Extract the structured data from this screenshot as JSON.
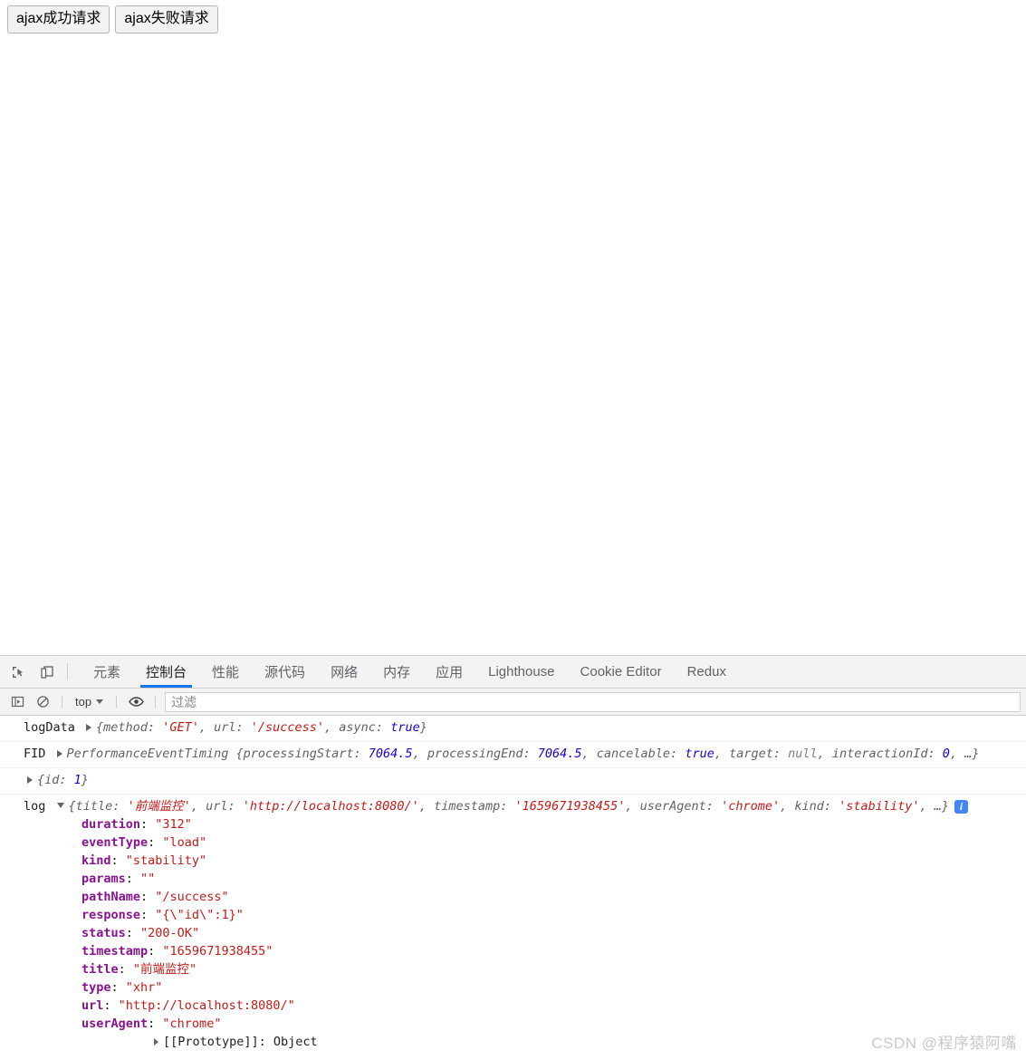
{
  "page": {
    "buttons": [
      {
        "label": "ajax成功请求",
        "name": "ajax-success-button"
      },
      {
        "label": "ajax失败请求",
        "name": "ajax-fail-button"
      }
    ]
  },
  "devtools": {
    "toolbar_icons": [
      {
        "name": "inspect-element-icon",
        "title": "检查元素"
      },
      {
        "name": "device-toolbar-icon",
        "title": "切换设备工具栏"
      }
    ],
    "tabs": [
      {
        "label": "元素",
        "active": false
      },
      {
        "label": "控制台",
        "active": true
      },
      {
        "label": "性能",
        "active": false
      },
      {
        "label": "源代码",
        "active": false
      },
      {
        "label": "网络",
        "active": false
      },
      {
        "label": "内存",
        "active": false
      },
      {
        "label": "应用",
        "active": false
      },
      {
        "label": "Lighthouse",
        "active": false
      },
      {
        "label": "Cookie Editor",
        "active": false
      },
      {
        "label": "Redux",
        "active": false
      }
    ],
    "filterbar": {
      "sidebar_icon": "console-sidebar-icon",
      "clear_icon": "clear-console-icon",
      "context": "top",
      "eye_icon": "live-expression-icon",
      "filter_placeholder": "过滤",
      "filter_value": ""
    }
  },
  "console": {
    "messages": [
      {
        "label": "logData",
        "expanded": false,
        "preview_parts": [
          {
            "t": "{method: ",
            "c": "preview"
          },
          {
            "t": "'GET'",
            "c": "str"
          },
          {
            "t": ", url: ",
            "c": "preview"
          },
          {
            "t": "'/success'",
            "c": "str"
          },
          {
            "t": ", async: ",
            "c": "preview"
          },
          {
            "t": "true",
            "c": "bool"
          },
          {
            "t": "}",
            "c": "preview"
          }
        ]
      },
      {
        "label": "FID",
        "expanded": false,
        "classname": "PerformanceEventTiming ",
        "preview_parts": [
          {
            "t": "{processingStart: ",
            "c": "preview"
          },
          {
            "t": "7064.5",
            "c": "num"
          },
          {
            "t": ", processingEnd: ",
            "c": "preview"
          },
          {
            "t": "7064.5",
            "c": "num"
          },
          {
            "t": ", cancelable: ",
            "c": "preview"
          },
          {
            "t": "true",
            "c": "bool"
          },
          {
            "t": ", target: ",
            "c": "preview"
          },
          {
            "t": "null",
            "c": "nullv"
          },
          {
            "t": ", interactionId: ",
            "c": "preview"
          },
          {
            "t": "0",
            "c": "num"
          },
          {
            "t": ", …}",
            "c": "preview"
          }
        ]
      },
      {
        "label": "",
        "expanded": false,
        "preview_parts": [
          {
            "t": "{id: ",
            "c": "preview"
          },
          {
            "t": "1",
            "c": "num"
          },
          {
            "t": "}",
            "c": "preview"
          }
        ]
      },
      {
        "label": "log",
        "expanded": true,
        "badge": "i",
        "preview_parts": [
          {
            "t": "{title: ",
            "c": "preview"
          },
          {
            "t": "'前端监控'",
            "c": "str"
          },
          {
            "t": ", url: ",
            "c": "preview"
          },
          {
            "t": "'http://localhost:8080/'",
            "c": "str"
          },
          {
            "t": ", timestamp: ",
            "c": "preview"
          },
          {
            "t": "'1659671938455'",
            "c": "str"
          },
          {
            "t": ", userAgent: ",
            "c": "preview"
          },
          {
            "t": "'chrome'",
            "c": "str"
          },
          {
            "t": ", kind: ",
            "c": "preview"
          },
          {
            "t": "'stability'",
            "c": "str"
          },
          {
            "t": ", …}",
            "c": "preview"
          }
        ],
        "properties": [
          {
            "key": "duration",
            "value": "\"312\""
          },
          {
            "key": "eventType",
            "value": "\"load\""
          },
          {
            "key": "kind",
            "value": "\"stability\""
          },
          {
            "key": "params",
            "value": "\"\""
          },
          {
            "key": "pathName",
            "value": "\"/success\""
          },
          {
            "key": "response",
            "value": "\"{\\\"id\\\":1}\""
          },
          {
            "key": "status",
            "value": "\"200-OK\""
          },
          {
            "key": "timestamp",
            "value": "\"1659671938455\""
          },
          {
            "key": "title",
            "value": "\"前端监控\""
          },
          {
            "key": "type",
            "value": "\"xhr\""
          },
          {
            "key": "url",
            "value": "\"http://localhost:8080/\""
          },
          {
            "key": "userAgent",
            "value": "\"chrome\""
          }
        ],
        "prototype": "[[Prototype]]: Object"
      }
    ]
  },
  "watermark": "CSDN @程序猿阿嘴"
}
